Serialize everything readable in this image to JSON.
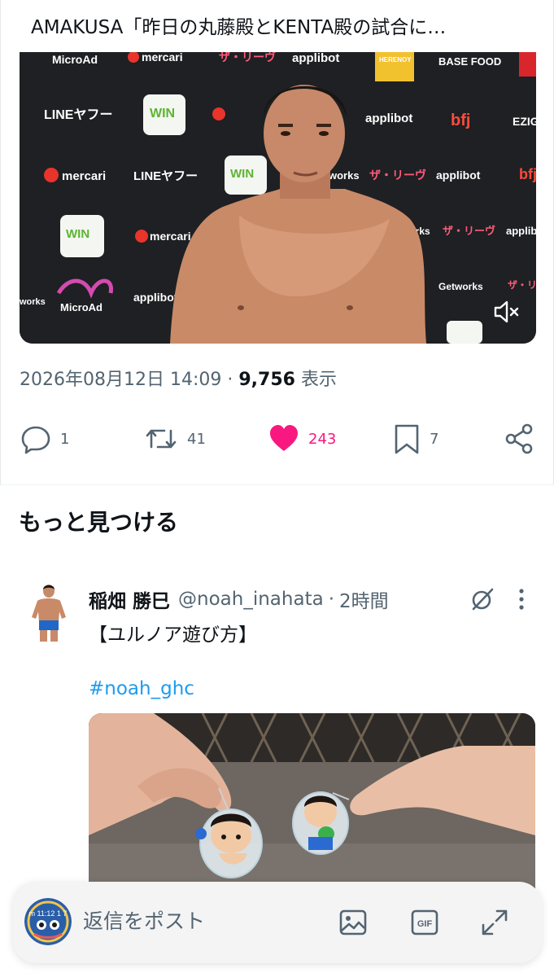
{
  "tweet": {
    "video_title": "AMAKUSA「昨日の丸藤殿とKENTA殿の試合に…",
    "timestamp": "2026年08月12日 14:09",
    "separator": "·",
    "views_count": "9,756",
    "views_label": "表示",
    "actions": {
      "reply_count": "1",
      "retweet_count": "41",
      "like_count": "243",
      "bookmark_count": "7"
    },
    "video_backdrop_logos": [
      "MicroAd",
      "mercari",
      "ザ・リーヴ",
      "applibot",
      "HERENOY",
      "BASE FOOD",
      "LINEヤフー",
      "WIN",
      "WINTICKET",
      "bfj",
      "EZIG",
      "works",
      "Getworks"
    ]
  },
  "discover": {
    "title": "もっと見つける"
  },
  "recommended_post": {
    "display_name": "稲畑 勝巳",
    "handle": "@noah_inahata",
    "separator": "·",
    "time": "2時間",
    "text": "【ユルノア遊び方】",
    "hashtag": "#noah_ghc"
  },
  "reply_bar": {
    "placeholder": "返信をポスト",
    "gif_label": "GIF",
    "avatar_text": "m 11:12 1 7"
  },
  "colors": {
    "like": "#f91880",
    "link": "#1d9bf0",
    "secondary_text": "#536471",
    "primary_text": "#0f1419"
  },
  "icons": [
    "speaker-mute-icon",
    "reply-icon",
    "retweet-icon",
    "heart-icon",
    "bookmark-icon",
    "share-icon",
    "grok-icon",
    "more-icon",
    "image-icon",
    "gif-icon",
    "expand-icon"
  ]
}
